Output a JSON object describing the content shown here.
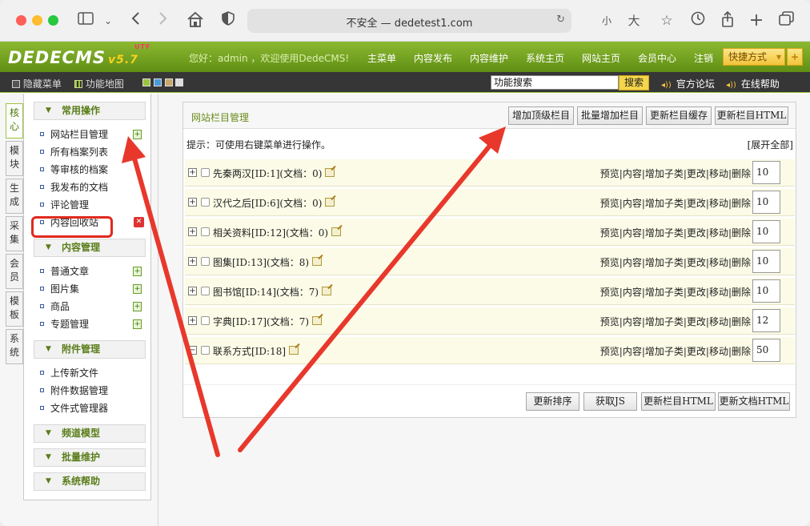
{
  "browser": {
    "url_text": "不安全 — dedetest1.com",
    "btn_small": "小",
    "btn_large": "大"
  },
  "header": {
    "logo": "DEDECMS",
    "version": "v5.7",
    "utf": "UTF",
    "greeting": "您好：admin ，欢迎使用DedeCMS!",
    "nav": [
      "主菜单",
      "内容发布",
      "内容维护",
      "系统主页",
      "网站主页",
      "会员中心",
      "注销"
    ],
    "quick": "快捷方式"
  },
  "subbar": {
    "hide_menu": "隐藏菜单",
    "sitemap": "功能地图",
    "search_value": "功能搜索",
    "search_btn": "搜索",
    "forum": "官方论坛",
    "help": "在线帮助"
  },
  "vtabs": [
    "核心",
    "模块",
    "生成",
    "采集",
    "会员",
    "模板",
    "系统"
  ],
  "menu": {
    "groups": [
      {
        "title": "常用操作",
        "items": [
          "网站栏目管理",
          "所有档案列表",
          "等审核的档案",
          "我发布的文档",
          "评论管理",
          "内容回收站"
        ]
      },
      {
        "title": "内容管理",
        "items": [
          "普通文章",
          "图片集",
          "商品",
          "专题管理"
        ]
      },
      {
        "title": "附件管理",
        "items": [
          "上传新文件",
          "附件数据管理",
          "文件式管理器"
        ]
      },
      {
        "title": "频道模型"
      },
      {
        "title": "批量维护"
      },
      {
        "title": "系统帮助"
      }
    ]
  },
  "panel": {
    "title": "网站栏目管理",
    "top_buttons": [
      "增加顶级栏目",
      "批量增加栏目",
      "更新栏目缓存",
      "更新栏目HTML"
    ],
    "tip": "提示：可使用右键菜单进行操作。",
    "expand_all": "[展开全部]",
    "ops": "预览|内容|增加子类|更改|移动|删除",
    "rows": [
      {
        "name": "先秦两汉[ID:1](文档：0)",
        "order": "10"
      },
      {
        "name": "汉代之后[ID:6](文档：0)",
        "order": "10"
      },
      {
        "name": "相关资料[ID:12](文档：0)",
        "order": "10"
      },
      {
        "name": "图集[ID:13](文档：8)",
        "order": "10"
      },
      {
        "name": "图书馆[ID:14](文档：7)",
        "order": "10"
      },
      {
        "name": "字典[ID:17](文档：7)",
        "order": "12"
      },
      {
        "name": "联系方式[ID:18]",
        "order": "50"
      }
    ],
    "bottom_buttons": [
      "更新排序",
      "获取JS",
      "更新栏目HTML",
      "更新文档HTML"
    ]
  },
  "colors": {
    "header_green": "#6f9c1c",
    "highlight_red": "#e0291e",
    "arrow_red": "#e8382c"
  }
}
